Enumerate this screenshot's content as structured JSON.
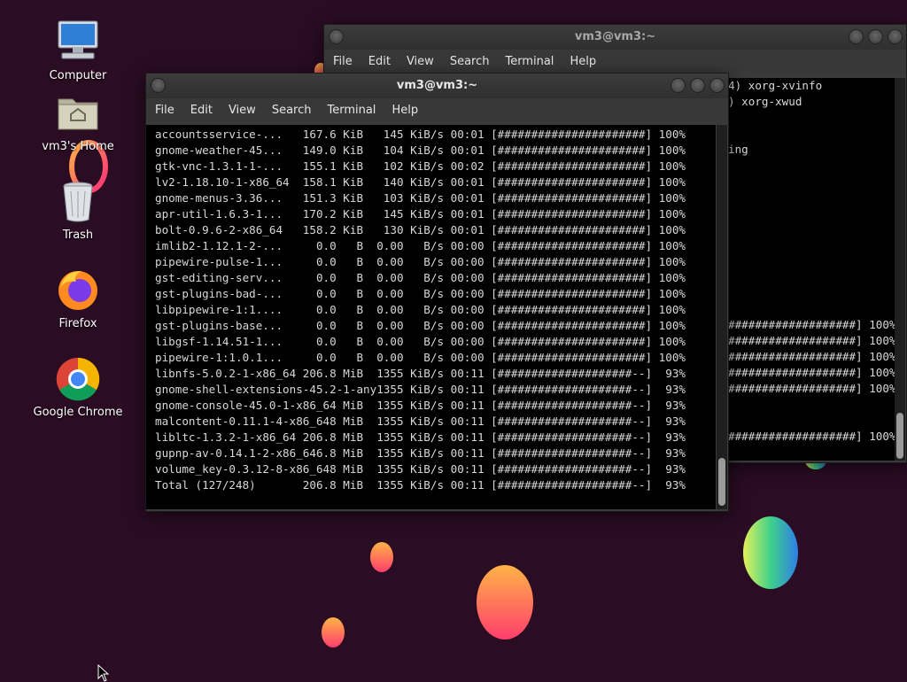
{
  "theme": {
    "terminal_fg": "#d8d8d8",
    "title_fg_active": "#e8e8e8",
    "title_fg_inactive": "#a8a8a8"
  },
  "desktop": {
    "icons": [
      {
        "label": "Computer",
        "icon": "computer-icon"
      },
      {
        "label": "vm3's Home",
        "icon": "home-folder-icon"
      },
      {
        "label": "Trash",
        "icon": "trash-icon"
      },
      {
        "label": "Firefox",
        "icon": "firefox-icon"
      },
      {
        "label": "Google Chrome",
        "icon": "chrome-icon"
      }
    ]
  },
  "back_window": {
    "title": "vm3@vm3:~",
    "menu": [
      "File",
      "Edit",
      "View",
      "Search",
      "Terminal",
      "Help"
    ],
    "lines": [
      "4) xorg-xvinfo",
      ") xorg-xwud",
      "",
      "",
      "ing",
      "",
      "",
      "",
      "",
      "",
      "",
      "",
      "",
      "",
      "",
      "###################] 100%",
      "###################] 100%",
      "###################] 100%",
      "###################] 100%",
      "###################] 100%",
      "",
      "",
      "###################] 100%"
    ]
  },
  "front_window": {
    "title": "vm3@vm3:~",
    "menu": [
      "File",
      "Edit",
      "View",
      "Search",
      "Terminal",
      "Help"
    ],
    "lines": [
      "accountsservice-...   167.6 KiB   145 KiB/s 00:01 [######################] 100%",
      "gnome-weather-45...   149.0 KiB   104 KiB/s 00:01 [######################] 100%",
      "gtk-vnc-1.3.1-1-...   155.1 KiB   102 KiB/s 00:02 [######################] 100%",
      "lv2-1.18.10-1-x86_64  158.1 KiB   140 KiB/s 00:01 [######################] 100%",
      "gnome-menus-3.36...   151.3 KiB   103 KiB/s 00:01 [######################] 100%",
      "apr-util-1.6.3-1...   170.2 KiB   145 KiB/s 00:01 [######################] 100%",
      "bolt-0.9.6-2-x86_64   158.2 KiB   130 KiB/s 00:01 [######################] 100%",
      "imlib2-1.12.1-2-...     0.0   B  0.00   B/s 00:00 [######################] 100%",
      "pipewire-pulse-1...     0.0   B  0.00   B/s 00:00 [######################] 100%",
      "gst-editing-serv...     0.0   B  0.00   B/s 00:00 [######################] 100%",
      "gst-plugins-bad-...     0.0   B  0.00   B/s 00:00 [######################] 100%",
      "libpipewire-1:1....     0.0   B  0.00   B/s 00:00 [######################] 100%",
      "gst-plugins-base...     0.0   B  0.00   B/s 00:00 [######################] 100%",
      "libgsf-1.14.51-1...     0.0   B  0.00   B/s 00:00 [######################] 100%",
      "pipewire-1:1.0.1...     0.0   B  0.00   B/s 00:00 [######################] 100%",
      "libnfs-5.0.2-1-x86_64 206.8 MiB  1355 KiB/s 00:11 [####################--]  93%",
      "gnome-shell-extensions-45.2-1-any1355 KiB/s 00:11 [####################--]  93%",
      "gnome-console-45.0-1-x86_64 MiB  1355 KiB/s 00:11 [####################--]  93%",
      "malcontent-0.11.1-4-x86_648 MiB  1355 KiB/s 00:11 [####################--]  93%",
      "libltc-1.3.2-1-x86_64 206.8 MiB  1355 KiB/s 00:11 [####################--]  93%",
      "gupnp-av-0.14.1-2-x86_646.8 MiB  1355 KiB/s 00:11 [####################--]  93%",
      "volume_key-0.3.12-8-x86_648 MiB  1355 KiB/s 00:11 [####################--]  93%",
      "Total (127/248)       206.8 MiB  1355 KiB/s 00:11 [####################--]  93%"
    ]
  }
}
